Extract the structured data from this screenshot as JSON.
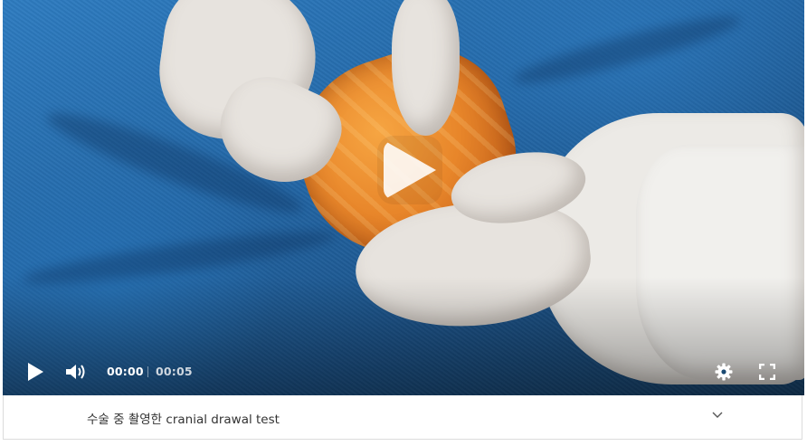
{
  "player": {
    "current_time": "00:00",
    "duration": "00:05",
    "icons": {
      "play": "play-icon",
      "big_play": "play-icon",
      "volume": "volume-icon",
      "settings": "gear-icon",
      "fullscreen": "fullscreen-icon"
    },
    "colors": {
      "drape": "#2368a8",
      "glove": "#e7e3de",
      "limb": "#e8862a",
      "control_text": "#ffffff"
    }
  },
  "caption_bar": {
    "title": "수술 중 촬영한 cranial drawal test",
    "toggle_icon": "chevron-down-icon"
  }
}
